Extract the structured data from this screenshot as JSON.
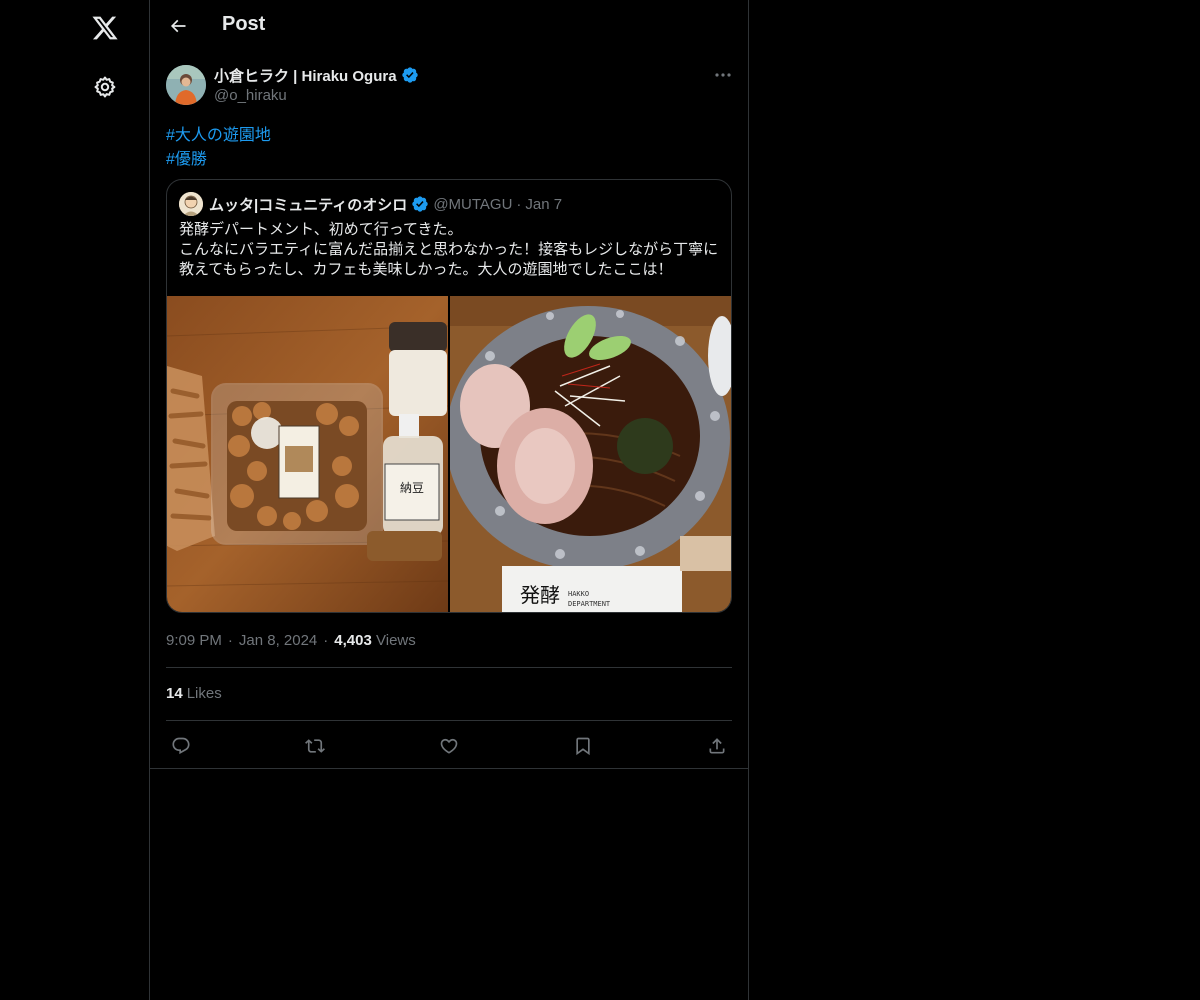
{
  "header": {
    "title": "Post"
  },
  "post": {
    "author_name": "小倉ヒラク | Hiraku Ogura",
    "handle": "@o_hiraku",
    "hashtags": [
      "#大人の遊園地",
      "#優勝"
    ],
    "time": "9:09 PM",
    "date": "Jan 8, 2024",
    "views_count": "4,403",
    "views_label": "Views",
    "likes_count": "14",
    "likes_label": "Likes",
    "separator": "·"
  },
  "quote": {
    "author_name": "ムッタ|コミュニティのオシロ",
    "handle": "@MUTAGU",
    "separator": "·",
    "date": "Jan 7",
    "text_lines": [
      "発酵デパートメント、初めて行ってきた。",
      "こんなにバラエティに富んだ品揃えと思わなかった！接客もレジしながら丁寧に",
      "教えてもらったし、カフェも美味しかった。大人の遊園地でしたここは！"
    ],
    "image1_label": "納豆",
    "image2_logo": "発酵",
    "image2_logo_sub1": "HAKKO",
    "image2_logo_sub2": "DEPARTMENT"
  },
  "colors": {
    "accent": "#1d9bf0",
    "muted": "#71767b",
    "border": "#2f3336",
    "background": "#000000"
  },
  "icons": [
    "x-logo-icon",
    "settings-icon",
    "back-arrow-icon",
    "verified-badge-icon",
    "more-icon",
    "reply-icon",
    "repost-icon",
    "like-icon",
    "bookmark-icon",
    "share-icon"
  ]
}
